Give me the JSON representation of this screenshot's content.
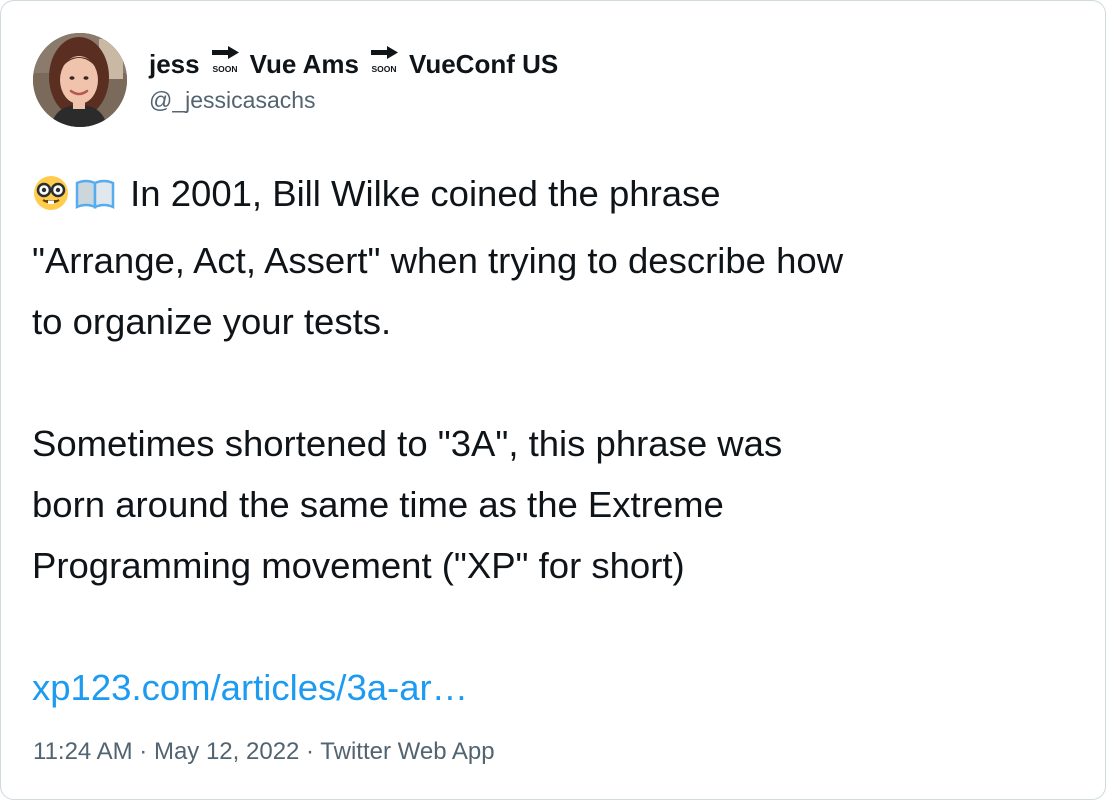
{
  "author": {
    "display_name_parts": [
      "jess",
      "Vue Ams",
      "VueConf US"
    ],
    "soon_label": "SOON",
    "handle": "@_jessicasachs"
  },
  "tweet": {
    "emojis": [
      "nerd-face-emoji",
      "open-book-emoji"
    ],
    "line1": "In 2001, Bill Wilke coined the phrase",
    "line2": "\"Arrange, Act, Assert\" when trying to describe how",
    "line3": "to organize your tests.",
    "line4": "Sometimes shortened to \"3A\", this phrase was",
    "line5": "born around the same time as the Extreme",
    "line6": "Programming movement (\"XP\" for short)",
    "link_text": "xp123.com/articles/3a-ar…"
  },
  "meta": {
    "time": "11:24 AM",
    "separator": " · ",
    "date": "May 12, 2022",
    "source": "Twitter Web App"
  },
  "colors": {
    "text": "#0f1419",
    "muted": "#536471",
    "link": "#1d9bf0",
    "border": "#cfd9de"
  }
}
